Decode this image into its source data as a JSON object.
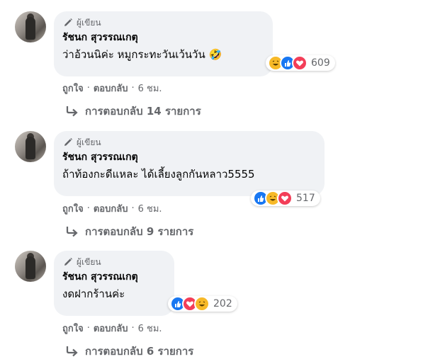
{
  "comments": [
    {
      "badge": "ผู้เขียน",
      "author": "รัชนก สุวรรณเกตุ",
      "text": "ว่าอ้วนนิค่ะ หมูกระทะวันเว้นวัน 🤣",
      "reactions": [
        "haha",
        "like",
        "love"
      ],
      "reaction_count": "609",
      "like_label": "ถูกใจ",
      "reply_label": "ตอบกลับ",
      "time": "6 ชม.",
      "replies_label": "การตอบกลับ 14 รายการ"
    },
    {
      "badge": "ผู้เขียน",
      "author": "รัชนก สุวรรณเกตุ",
      "text": "ถ้าท้องกะดีแหละ ได้เลี้ยงลูกกันหลาว5555",
      "reactions": [
        "like",
        "haha",
        "love"
      ],
      "reaction_count": "517",
      "like_label": "ถูกใจ",
      "reply_label": "ตอบกลับ",
      "time": "6 ชม.",
      "replies_label": "การตอบกลับ 9 รายการ"
    },
    {
      "badge": "ผู้เขียน",
      "author": "รัชนก สุวรรณเกตุ",
      "text": "งดฝากร้านค่ะ",
      "reactions": [
        "like",
        "love",
        "haha"
      ],
      "reaction_count": "202",
      "like_label": "ถูกใจ",
      "reply_label": "ตอบกลับ",
      "time": "6 ชม.",
      "replies_label": "การตอบกลับ 6 รายการ"
    }
  ],
  "colors": {
    "bubble": "#f0f2f5",
    "secondary_text": "#65676b",
    "like": "#1877f2",
    "love": "#f33e58",
    "haha": "#f7b928"
  }
}
